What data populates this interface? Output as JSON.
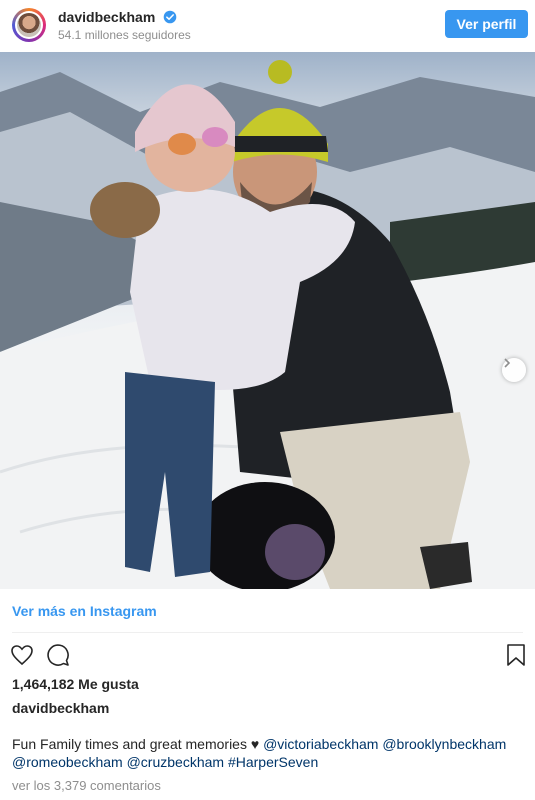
{
  "header": {
    "username": "davidbeckham",
    "verified_icon": "verified-badge-icon",
    "followers": "54.1 millones seguidores",
    "profile_button": "Ver perfil",
    "accent_color": "#3897f0"
  },
  "post": {
    "photo_alt": "Photo post",
    "next_icon": "chevron-right-icon",
    "more_link": "Ver más en Instagram"
  },
  "actions": {
    "like_icon": "heart-icon",
    "comment_icon": "comment-icon",
    "save_icon": "bookmark-icon"
  },
  "stats": {
    "likes": "1,464,182 Me gusta"
  },
  "caption": {
    "username": "davidbeckham",
    "text": "Fun Family times and great memories ♥",
    "mentions": [
      "@victoriabeckham",
      "@brooklynbeckham",
      "@romeobeckham",
      "@cruzbeckham",
      "#HarperSeven"
    ]
  },
  "comments_link": "ver los 3,379 comentarios"
}
